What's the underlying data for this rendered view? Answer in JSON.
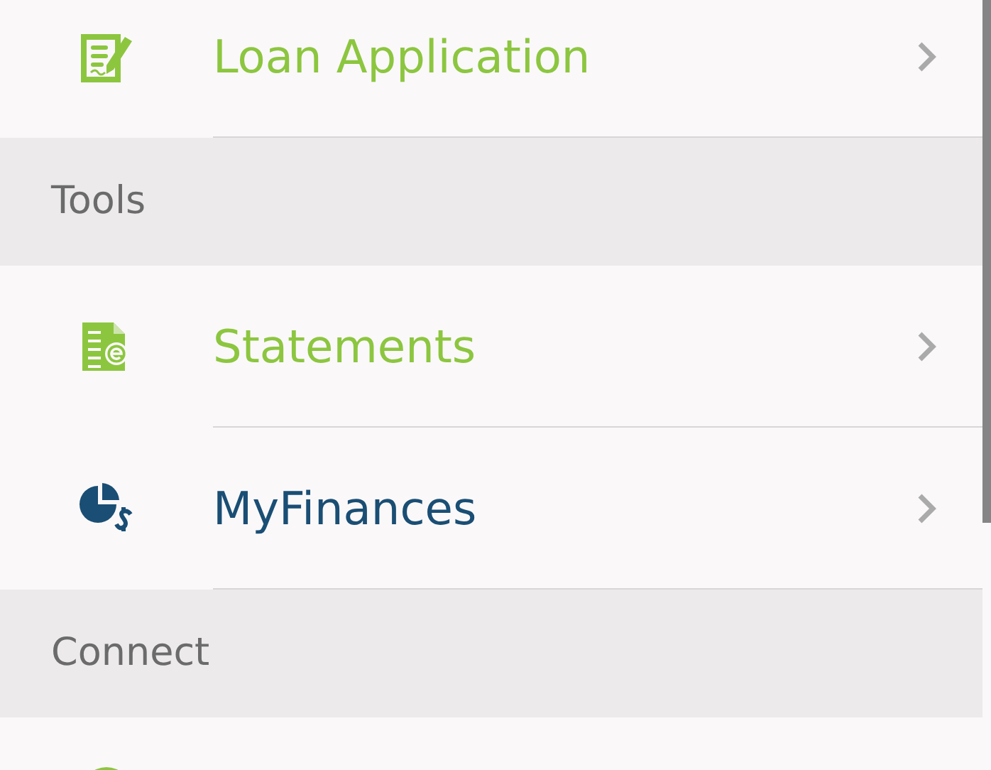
{
  "menu": [
    {
      "kind": "item",
      "label": "Loan Application",
      "color": "#8cc63f"
    },
    {
      "kind": "header",
      "label": "Tools"
    },
    {
      "kind": "item",
      "label": "Statements",
      "color": "#8cc63f"
    },
    {
      "kind": "item",
      "label": "MyFinances",
      "color": "#1a4e74"
    },
    {
      "kind": "header",
      "label": "Connect"
    },
    {
      "kind": "item",
      "color": "#8cc63f"
    }
  ]
}
